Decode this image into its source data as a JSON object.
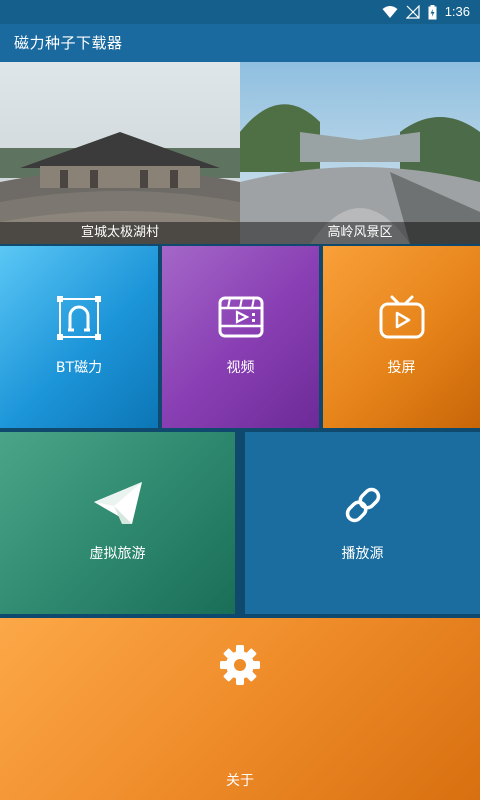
{
  "status_bar": {
    "time": "1:36",
    "icons": [
      "wifi-icon",
      "no-signal-icon",
      "battery-charging-icon"
    ]
  },
  "app_bar": {
    "title": "磁力种子下载器"
  },
  "banners": [
    {
      "caption": "宣城太极湖村"
    },
    {
      "caption": "高岭风景区"
    }
  ],
  "tiles": {
    "bt": {
      "label": "BT磁力",
      "icon": "magnet-icon",
      "color": "#1d95d9"
    },
    "video": {
      "label": "视频",
      "icon": "video-film-icon",
      "color": "#8a40b4"
    },
    "cast": {
      "label": "投屏",
      "icon": "tv-play-icon",
      "color": "#e6841a"
    },
    "tour": {
      "label": "虚拟旅游",
      "icon": "paper-plane-icon",
      "color": "#2f8a70"
    },
    "source": {
      "label": "播放源",
      "icon": "link-icon",
      "color": "#1a6d9e"
    },
    "about": {
      "label": "关于",
      "icon": "gear-icon",
      "color": "#ef8c2a"
    }
  }
}
